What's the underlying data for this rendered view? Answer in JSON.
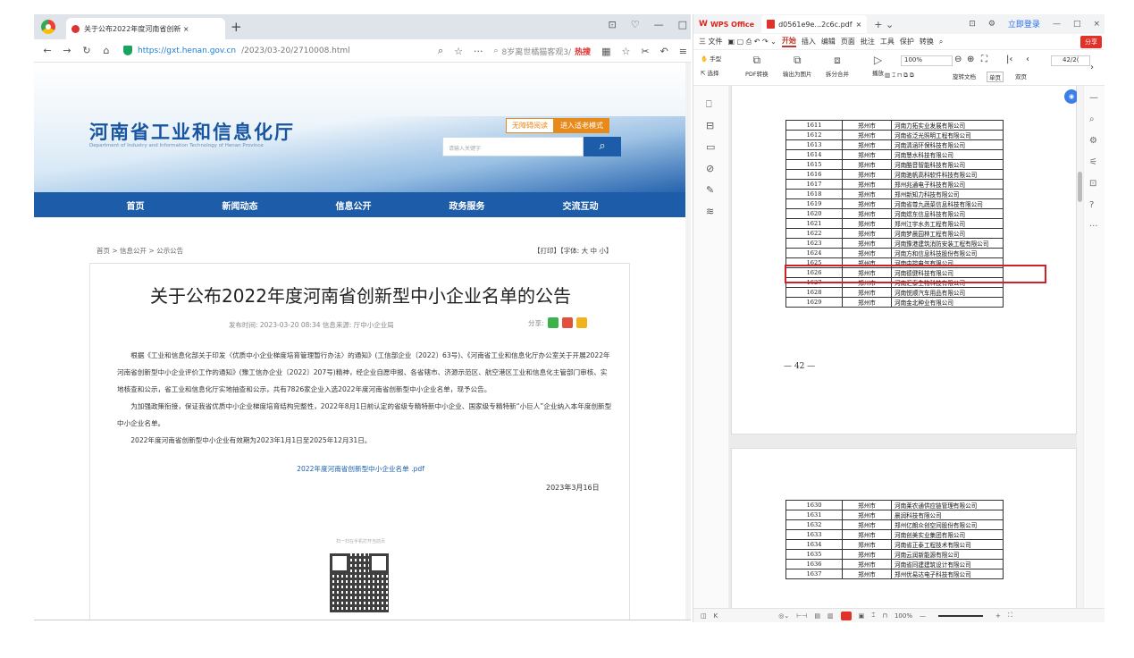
{
  "browser": {
    "tab_title": "关于公布2022年度河南省创新 ×",
    "url_https": "https://gxt.henan.gov.cn",
    "url_path": "/2023/03-20/2710008.html",
    "search_text": "8岁离世橘猫客观3/",
    "search_hot": "热搜"
  },
  "site": {
    "logo_cn": "河南省工业和信息化厅",
    "logo_en": "Department of Industry and Information Technology of Henan Province",
    "accessibility_label": "无障碍阅读",
    "elder_mode_label": "进入适老模式",
    "search_placeholder": "请输入关键字",
    "nav": [
      "首页",
      "新闻动态",
      "信息公开",
      "政务服务",
      "交流互动"
    ],
    "breadcrumb": "首页 > 信息公开 > 公示公告",
    "print_font": "【打印】【字体: 大 中 小】",
    "article": {
      "title": "关于公布2022年度河南省创新型中小企业名单的公告",
      "meta": "发布时间: 2023-03-20 08:34   信息来源: 厅中小企业局",
      "share_label": "分享:",
      "para1": "根据《工业和信息化部关于印发〈优质中小企业梯度培育管理暂行办法〉的通知》(工信部企业〔2022〕63号)、《河南省工业和信息化厅办公室关于开展2022年河南省创新型中小企业评价工作的通知》(豫工信办企业〔2022〕207号)精神，经企业自愿申报、各省辖市、济源示范区、航空港区工业和信息化主管部门审核、实地核查和公示，省工业和信息化厅实地抽查和公示，共有7826家企业入选2022年度河南省创新型中小企业名单，现予公告。",
      "para2": "为加强政策衔接，保证我省优质中小企业梯度培育结构完整性，2022年8月1日前认定的省级专精特新中小企业、国家级专精特新“小巨人”企业纳入本年度创新型中小企业名单。",
      "para3": "2022年度河南省创新型中小企业有效期为2023年1月1日至2025年12月31日。",
      "attachment": "2022年度河南省创新型中小企业名单 .pdf",
      "date": "2023年3月16日",
      "qr_label": "扫一扫在手机打开当前页"
    }
  },
  "wps": {
    "app_name": "WPS Office",
    "doc_tab": "d0561e9e...2c6c.pdf",
    "login": "立即登录",
    "menu": [
      "三 文件",
      "开始",
      "插入",
      "编辑",
      "页面",
      "批注",
      "工具",
      "保护",
      "转换"
    ],
    "menu_active": "开始",
    "share": "分享",
    "toolbar": {
      "hand": "手型",
      "select": "选择",
      "pdf_convert": "PDF转换",
      "export_img": "输出为图片",
      "split_merge": "拆分合并",
      "play": "播放",
      "rotate": "旋转文档",
      "single": "单页",
      "double": "双页",
      "zoom": "100%",
      "page": "42/2("
    },
    "page_number": "— 42 —",
    "status_zoom": "100%",
    "rows_p42": [
      [
        "1611",
        "郑州市",
        "河南力拓实业发展有限公司"
      ],
      [
        "1612",
        "郑州市",
        "河南省泛光照明工程有限公司"
      ],
      [
        "1613",
        "郑州市",
        "河南清涵环保科技有限公司"
      ],
      [
        "1614",
        "郑州市",
        "河南慧水科技有限公司"
      ],
      [
        "1615",
        "郑州市",
        "河南酷音智能科技有限公司"
      ],
      [
        "1616",
        "郑州市",
        "河南驰帆高科软件科技有限公司"
      ],
      [
        "1617",
        "郑州市",
        "郑州兆通电子科技有限公司"
      ],
      [
        "1618",
        "郑州市",
        "郑州新知力科技有限公司"
      ],
      [
        "1619",
        "郑州市",
        "河南省尊九蔬菜信息科技有限公司"
      ],
      [
        "1620",
        "郑州市",
        "河南煜东信息科技有限公司"
      ],
      [
        "1621",
        "郑州市",
        "郑州江宇水务工程有限公司"
      ],
      [
        "1622",
        "郑州市",
        "河南梦晨园林工程有限公司"
      ],
      [
        "1623",
        "郑州市",
        "河南豫港建筑消防安装工程有限公司"
      ],
      [
        "1624",
        "郑州市",
        "河南方和信息科技股份有限公司"
      ],
      [
        "1625",
        "郑州市",
        "河南中控电气有限公司"
      ],
      [
        "1626",
        "郑州市",
        "河南德健科技有限公司"
      ],
      [
        "1627",
        "郑州市",
        "河南汇泰生物科技有限公司"
      ],
      [
        "1628",
        "郑州市",
        "河南悦顺汽车用品有限公司"
      ],
      [
        "1629",
        "郑州市",
        "河南金北种业有限公司"
      ]
    ],
    "rows_p43": [
      [
        "1630",
        "郑州市",
        "河南莱农通供应链管理有限公司"
      ],
      [
        "1631",
        "郑州市",
        "晨润科技有限公司"
      ],
      [
        "1632",
        "郑州市",
        "郑州亿朗众创空间股份有限公司"
      ],
      [
        "1633",
        "郑州市",
        "河南创美实业集团有限公司"
      ],
      [
        "1634",
        "郑州市",
        "河南省正泰工程技术有限公司"
      ],
      [
        "1635",
        "郑州市",
        "河南云润新能源有限公司"
      ],
      [
        "1636",
        "郑州市",
        "河南省同建建筑设计有限公司"
      ],
      [
        "1637",
        "郑州市",
        "郑州优易达电子科技有限公司"
      ]
    ]
  }
}
